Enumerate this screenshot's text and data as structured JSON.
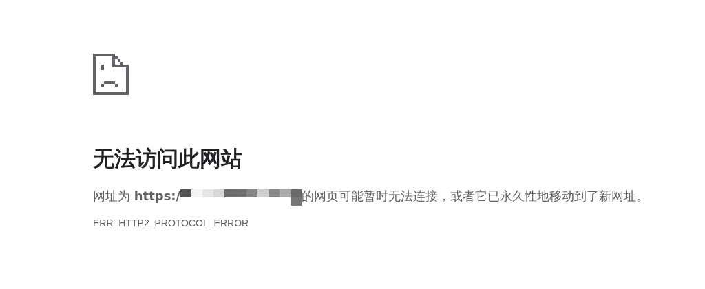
{
  "heading": "无法访问此网站",
  "message": {
    "before": "网址为 **https:/**",
    "after": "的网页可能暂时无法连接，或者它已永久性地移动到了新网址。"
  },
  "error_code": "ERR_HTTP2_PROTOCOL_ERROR"
}
